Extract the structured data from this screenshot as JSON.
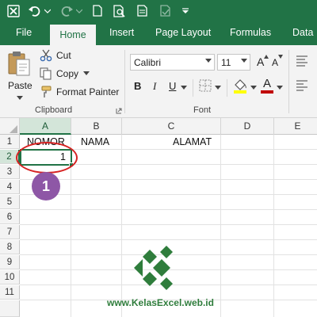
{
  "ribbon_tabs": [
    "File",
    "Home",
    "Insert",
    "Page Layout",
    "Formulas",
    "Data"
  ],
  "clipboard": {
    "paste_label": "Paste",
    "cut_label": "Cut",
    "copy_label": "Copy",
    "format_painter_label": "Format Painter",
    "group_label": "Clipboard"
  },
  "font": {
    "font_name": "Calibri",
    "font_size": "11",
    "group_label": "Font",
    "bold_label": "B",
    "italic_label": "I",
    "underline_label": "U",
    "font_color_label": "A",
    "grow_label": "A",
    "shrink_label": "A",
    "highlight_color": "#ffff00",
    "font_color": "#c00000"
  },
  "grid": {
    "columns": [
      "A",
      "B",
      "C",
      "D",
      "E"
    ],
    "rows": [
      "1",
      "2",
      "3",
      "4",
      "5",
      "6",
      "7",
      "8",
      "9",
      "10",
      "11"
    ],
    "cells": {
      "A1": "NOMOR",
      "B1": "NAMA",
      "C1": "ALAMAT",
      "A2": "1"
    }
  },
  "annotation": {
    "step_number": "1",
    "circle_color": "#d62222",
    "badge_color": "#8e57a6"
  },
  "watermark": {
    "text": "www.KelasExcel.web.id",
    "color": "#2f7d3c"
  },
  "colors": {
    "ribbon_green": "#217346",
    "selection_green": "#217346"
  }
}
